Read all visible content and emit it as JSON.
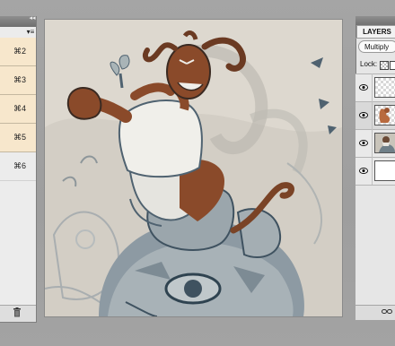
{
  "actions_panel": {
    "collapse_glyph": "◂◂",
    "menu_glyph": "▾≡",
    "shortcuts": [
      "⌘2",
      "⌘3",
      "⌘4",
      "⌘5",
      "⌘6"
    ],
    "highlight_color": "#f7e7cc"
  },
  "layers_panel": {
    "tab_label": "LAYERS",
    "blend_mode": "Multiply",
    "lock_label": "Lock:",
    "layers": [
      {
        "thumbnail": "transparent-sketch",
        "visible": true,
        "selected": false
      },
      {
        "thumbnail": "colored-figure",
        "visible": true,
        "selected": true
      },
      {
        "thumbnail": "illustration",
        "visible": true,
        "selected": false
      },
      {
        "thumbnail": "white-background",
        "visible": true,
        "selected": false
      }
    ]
  },
  "canvas": {
    "content": "illustration-devil-character-on-stone-statue",
    "paper_color": "#cfc9c0",
    "ink_color": "#4f6270",
    "skin_color": "#8a4a2a"
  }
}
